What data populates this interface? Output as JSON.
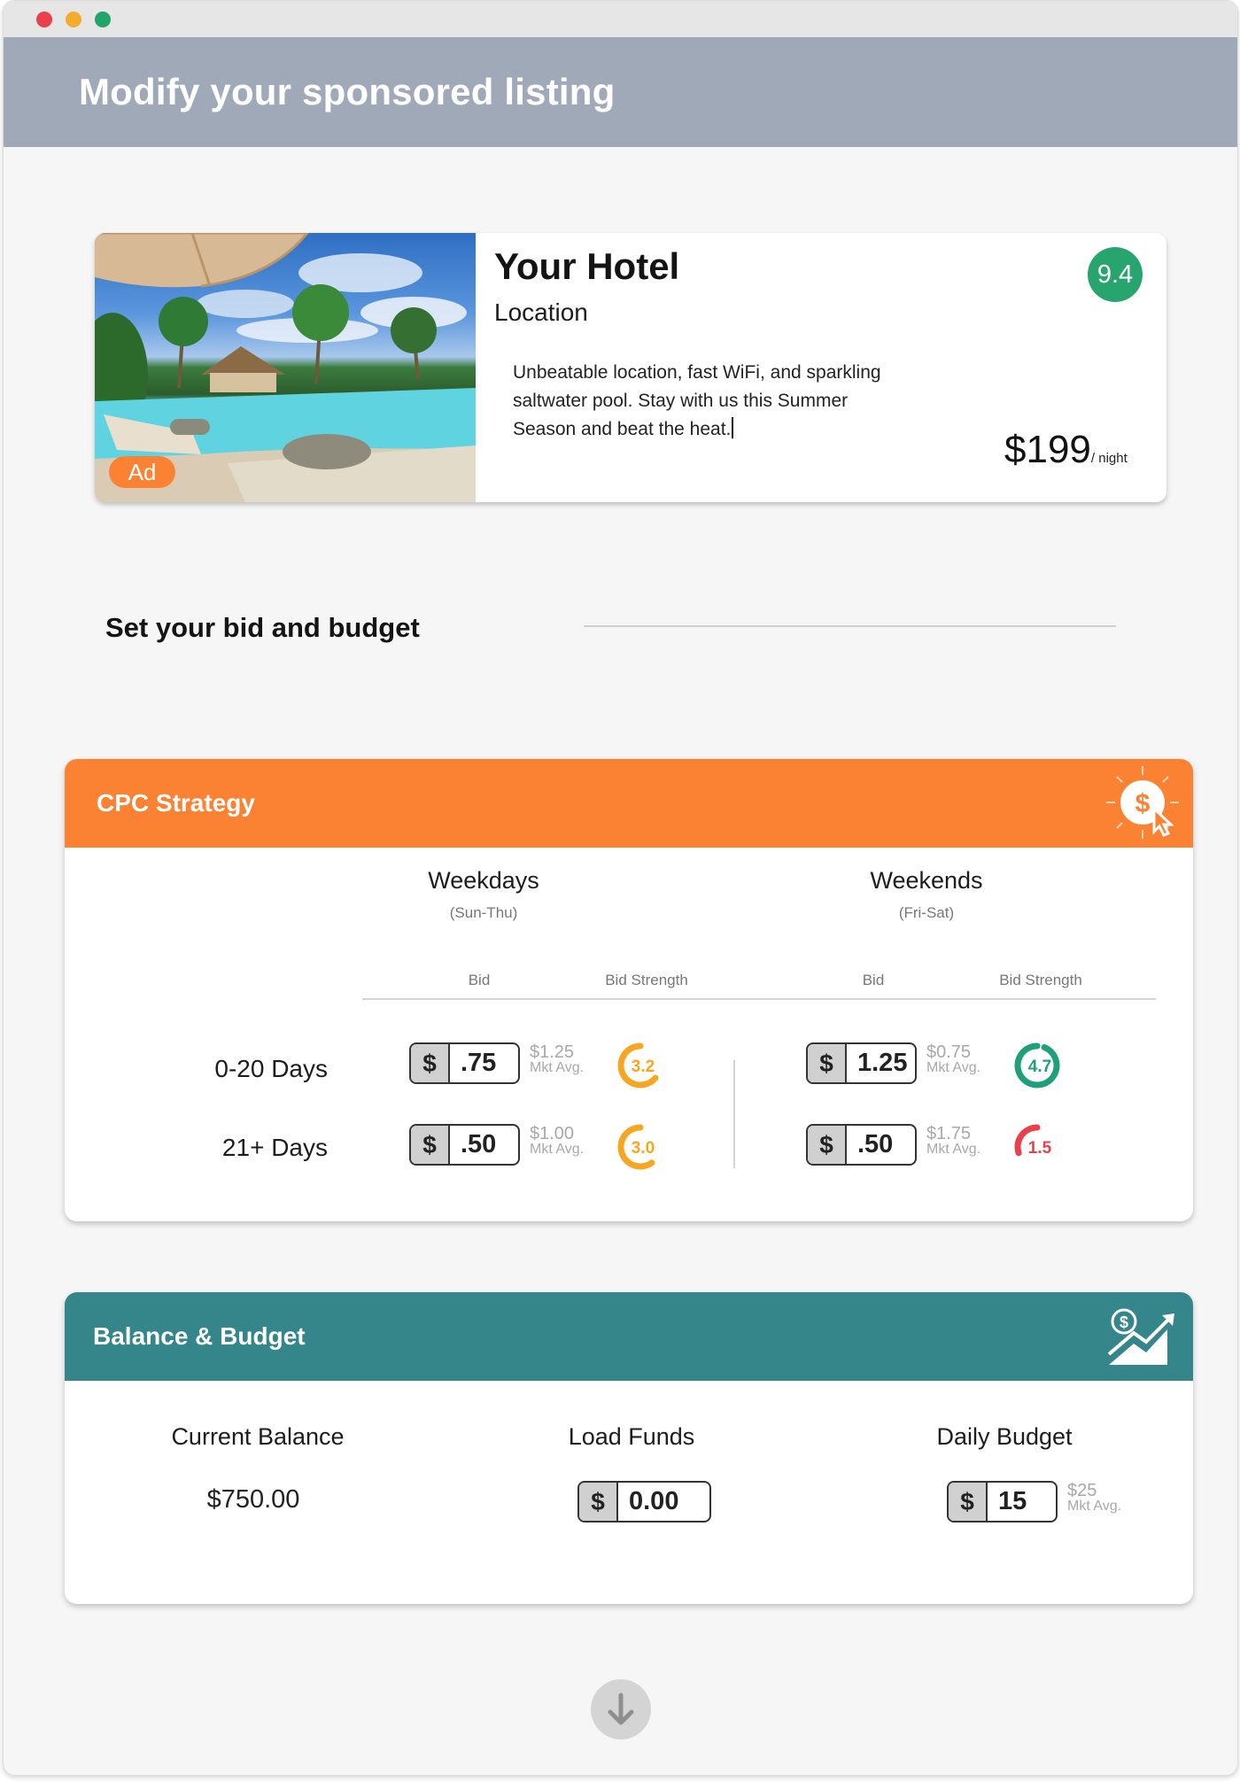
{
  "page": {
    "title": "Modify your sponsored listing"
  },
  "listing": {
    "ad_badge": "Ad",
    "hotel_name": "Your Hotel",
    "location": "Location",
    "description": "Unbeatable location, fast WiFi, and sparkling saltwater pool. Stay with us this Summer Season and beat the heat.",
    "rating": "9.4",
    "price": "$199",
    "price_unit": "/ night"
  },
  "bid_section": {
    "title": "Set your bid and budget"
  },
  "cpc": {
    "title": "CPC Strategy",
    "icon": "dollar-click-icon",
    "weekdays": {
      "label": "Weekdays",
      "sub": "(Sun-Thu)"
    },
    "weekends": {
      "label": "Weekends",
      "sub": "(Fri-Sat)"
    },
    "bid_header": "Bid",
    "strength_header": "Bid Strength",
    "currency": "$",
    "mkt_label": "Mkt Avg.",
    "rows": [
      {
        "label": "0-20 Days",
        "weekday": {
          "bid": ".75",
          "mkt": "$1.25",
          "strength": "3.2"
        },
        "weekend": {
          "bid": "1.25",
          "mkt": "$0.75",
          "strength": "4.7"
        }
      },
      {
        "label": "21+  Days",
        "weekday": {
          "bid": ".50",
          "mkt": "$1.00",
          "strength": "3.0"
        },
        "weekend": {
          "bid": ".50",
          "mkt": "$1.75",
          "strength": "1.5"
        }
      }
    ],
    "strength_colors": {
      "mid": "#f5a623",
      "high": "#1fa07a",
      "low": "#e8414b"
    }
  },
  "balance": {
    "title": "Balance & Budget",
    "icon": "money-growth-icon",
    "current_balance_label": "Current Balance",
    "current_balance": "$750.00",
    "load_funds_label": "Load Funds",
    "load_funds_value": "0.00",
    "daily_budget_label": "Daily Budget",
    "daily_budget_value": "15",
    "daily_budget_mkt": "$25",
    "mkt_label": "Mkt Avg.",
    "currency": "$"
  },
  "footer": {
    "icon": "arrow-down-icon"
  },
  "colors": {
    "header_bg": "#a0a9b8",
    "cpc_orange": "#fb8233",
    "balance_teal": "#34868a",
    "rating_green": "#28a56f"
  }
}
